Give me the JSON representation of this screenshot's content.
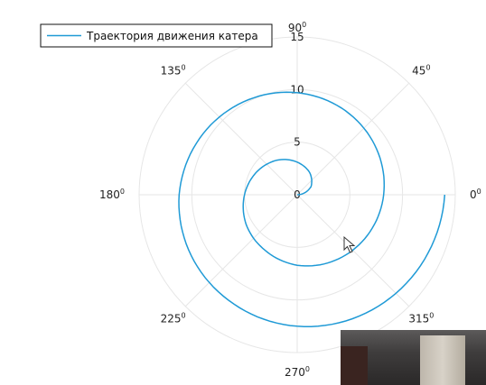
{
  "chart_data": {
    "type": "line",
    "projection": "polar",
    "legend_position": "top-left",
    "grid": true,
    "r_ticks": [
      "0",
      "5",
      "10",
      "15"
    ],
    "r_tick_values": [
      0,
      5,
      10,
      15
    ],
    "r_max": 15,
    "theta_tick_values": [
      0,
      45,
      90,
      135,
      180,
      225,
      270,
      315
    ],
    "theta_labels": [
      {
        "deg": "0",
        "sup": "0"
      },
      {
        "deg": "45",
        "sup": "0"
      },
      {
        "deg": "90",
        "sup": "0"
      },
      {
        "deg": "135",
        "sup": "0"
      },
      {
        "deg": "180",
        "sup": "0"
      },
      {
        "deg": "225",
        "sup": "0"
      },
      {
        "deg": "270",
        "sup": "0"
      },
      {
        "deg": "315",
        "sup": "0"
      }
    ],
    "series": [
      {
        "name": "Траектория движения катера",
        "color": "#1f9ad6",
        "theta": [
          0,
          30,
          60,
          90,
          120,
          150,
          180,
          210,
          240,
          270,
          300,
          330,
          360,
          390,
          420,
          450,
          480,
          510,
          540,
          570,
          600,
          630,
          660,
          690,
          720
        ],
        "r": [
          0.01,
          1.5,
          2.4,
          3.1,
          3.8,
          4.4,
          5.0,
          5.6,
          6.1,
          6.7,
          7.2,
          7.7,
          8.2,
          8.7,
          9.2,
          9.7,
          10.2,
          10.7,
          11.2,
          11.6,
          12.0,
          12.5,
          13.0,
          13.5,
          14.0
        ]
      }
    ]
  },
  "colors": {
    "grid": "#e6e6e6",
    "frame": "#111111"
  },
  "icons": {
    "cursor": "mouse-pointer-icon"
  }
}
